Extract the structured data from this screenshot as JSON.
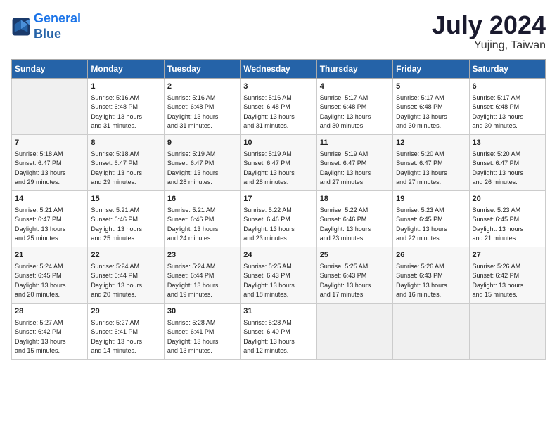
{
  "header": {
    "logo_line1": "General",
    "logo_line2": "Blue",
    "month_year": "July 2024",
    "location": "Yujing, Taiwan"
  },
  "weekdays": [
    "Sunday",
    "Monday",
    "Tuesday",
    "Wednesday",
    "Thursday",
    "Friday",
    "Saturday"
  ],
  "weeks": [
    [
      {
        "day": "",
        "empty": true
      },
      {
        "day": "1",
        "sunrise": "5:16 AM",
        "sunset": "6:48 PM",
        "daylight": "13 hours and 31 minutes."
      },
      {
        "day": "2",
        "sunrise": "5:16 AM",
        "sunset": "6:48 PM",
        "daylight": "13 hours and 31 minutes."
      },
      {
        "day": "3",
        "sunrise": "5:16 AM",
        "sunset": "6:48 PM",
        "daylight": "13 hours and 31 minutes."
      },
      {
        "day": "4",
        "sunrise": "5:17 AM",
        "sunset": "6:48 PM",
        "daylight": "13 hours and 30 minutes."
      },
      {
        "day": "5",
        "sunrise": "5:17 AM",
        "sunset": "6:48 PM",
        "daylight": "13 hours and 30 minutes."
      },
      {
        "day": "6",
        "sunrise": "5:17 AM",
        "sunset": "6:48 PM",
        "daylight": "13 hours and 30 minutes."
      }
    ],
    [
      {
        "day": "7",
        "sunrise": "5:18 AM",
        "sunset": "6:47 PM",
        "daylight": "13 hours and 29 minutes."
      },
      {
        "day": "8",
        "sunrise": "5:18 AM",
        "sunset": "6:47 PM",
        "daylight": "13 hours and 29 minutes."
      },
      {
        "day": "9",
        "sunrise": "5:19 AM",
        "sunset": "6:47 PM",
        "daylight": "13 hours and 28 minutes."
      },
      {
        "day": "10",
        "sunrise": "5:19 AM",
        "sunset": "6:47 PM",
        "daylight": "13 hours and 28 minutes."
      },
      {
        "day": "11",
        "sunrise": "5:19 AM",
        "sunset": "6:47 PM",
        "daylight": "13 hours and 27 minutes."
      },
      {
        "day": "12",
        "sunrise": "5:20 AM",
        "sunset": "6:47 PM",
        "daylight": "13 hours and 27 minutes."
      },
      {
        "day": "13",
        "sunrise": "5:20 AM",
        "sunset": "6:47 PM",
        "daylight": "13 hours and 26 minutes."
      }
    ],
    [
      {
        "day": "14",
        "sunrise": "5:21 AM",
        "sunset": "6:47 PM",
        "daylight": "13 hours and 25 minutes."
      },
      {
        "day": "15",
        "sunrise": "5:21 AM",
        "sunset": "6:46 PM",
        "daylight": "13 hours and 25 minutes."
      },
      {
        "day": "16",
        "sunrise": "5:21 AM",
        "sunset": "6:46 PM",
        "daylight": "13 hours and 24 minutes."
      },
      {
        "day": "17",
        "sunrise": "5:22 AM",
        "sunset": "6:46 PM",
        "daylight": "13 hours and 23 minutes."
      },
      {
        "day": "18",
        "sunrise": "5:22 AM",
        "sunset": "6:46 PM",
        "daylight": "13 hours and 23 minutes."
      },
      {
        "day": "19",
        "sunrise": "5:23 AM",
        "sunset": "6:45 PM",
        "daylight": "13 hours and 22 minutes."
      },
      {
        "day": "20",
        "sunrise": "5:23 AM",
        "sunset": "6:45 PM",
        "daylight": "13 hours and 21 minutes."
      }
    ],
    [
      {
        "day": "21",
        "sunrise": "5:24 AM",
        "sunset": "6:45 PM",
        "daylight": "13 hours and 20 minutes."
      },
      {
        "day": "22",
        "sunrise": "5:24 AM",
        "sunset": "6:44 PM",
        "daylight": "13 hours and 20 minutes."
      },
      {
        "day": "23",
        "sunrise": "5:24 AM",
        "sunset": "6:44 PM",
        "daylight": "13 hours and 19 minutes."
      },
      {
        "day": "24",
        "sunrise": "5:25 AM",
        "sunset": "6:43 PM",
        "daylight": "13 hours and 18 minutes."
      },
      {
        "day": "25",
        "sunrise": "5:25 AM",
        "sunset": "6:43 PM",
        "daylight": "13 hours and 17 minutes."
      },
      {
        "day": "26",
        "sunrise": "5:26 AM",
        "sunset": "6:43 PM",
        "daylight": "13 hours and 16 minutes."
      },
      {
        "day": "27",
        "sunrise": "5:26 AM",
        "sunset": "6:42 PM",
        "daylight": "13 hours and 15 minutes."
      }
    ],
    [
      {
        "day": "28",
        "sunrise": "5:27 AM",
        "sunset": "6:42 PM",
        "daylight": "13 hours and 15 minutes."
      },
      {
        "day": "29",
        "sunrise": "5:27 AM",
        "sunset": "6:41 PM",
        "daylight": "13 hours and 14 minutes."
      },
      {
        "day": "30",
        "sunrise": "5:28 AM",
        "sunset": "6:41 PM",
        "daylight": "13 hours and 13 minutes."
      },
      {
        "day": "31",
        "sunrise": "5:28 AM",
        "sunset": "6:40 PM",
        "daylight": "13 hours and 12 minutes."
      },
      {
        "day": "",
        "empty": true
      },
      {
        "day": "",
        "empty": true
      },
      {
        "day": "",
        "empty": true
      }
    ]
  ]
}
